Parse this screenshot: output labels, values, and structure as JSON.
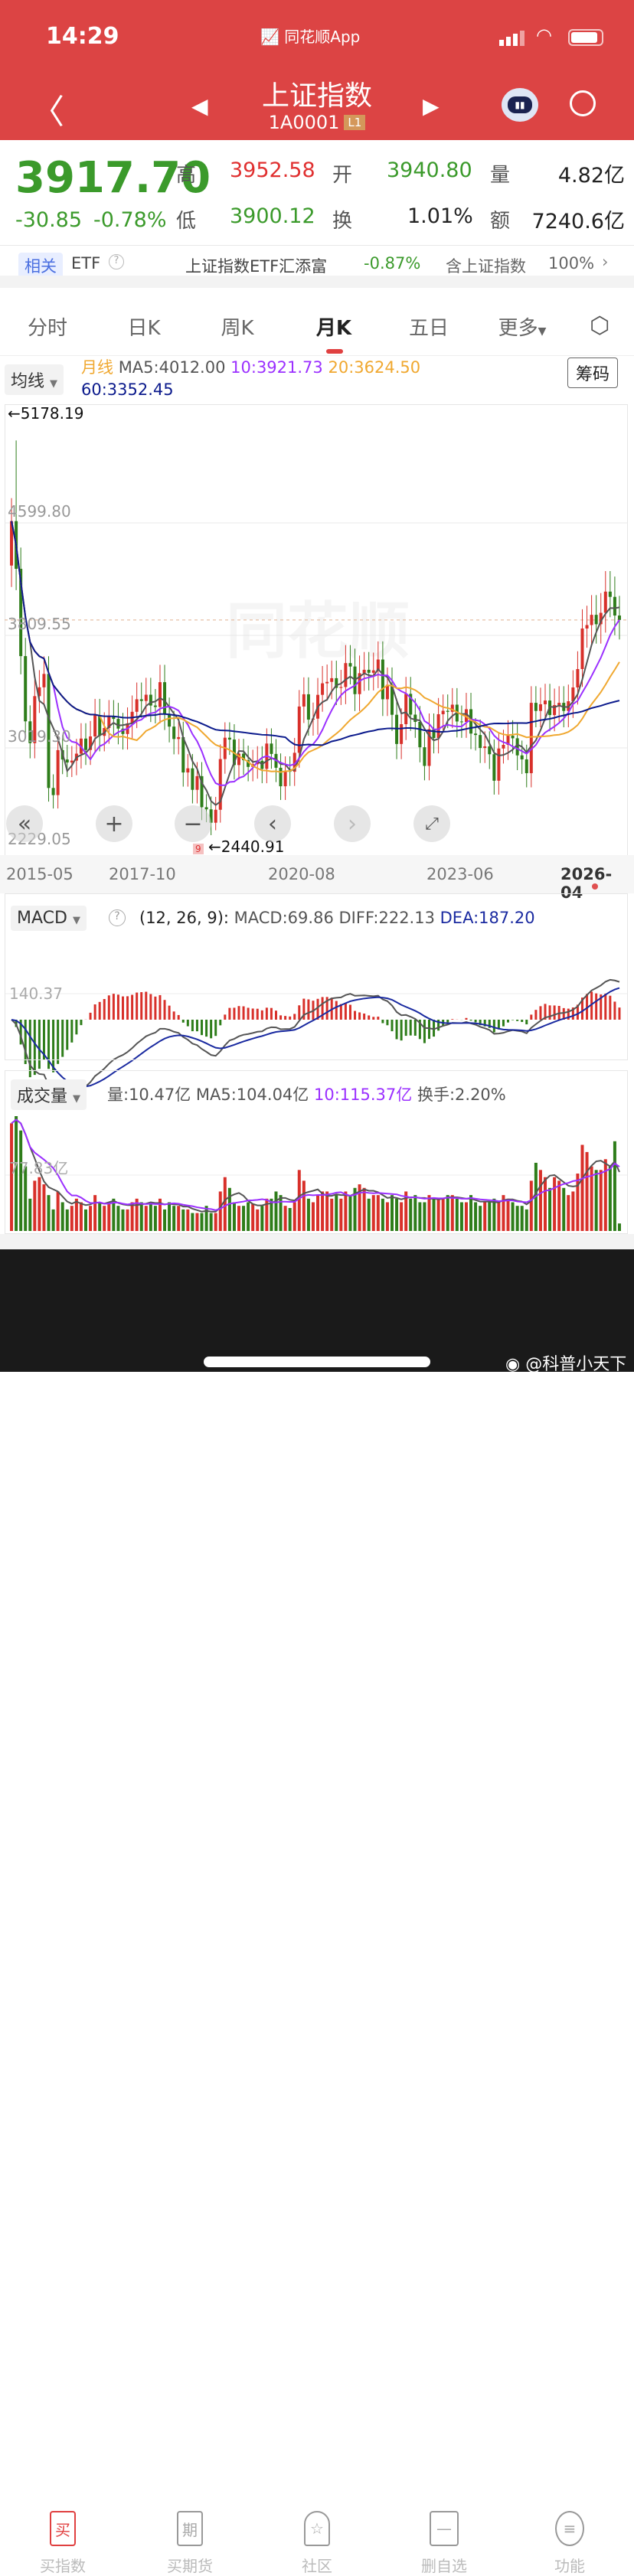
{
  "status": {
    "time": "14:29",
    "app": "同花顺App"
  },
  "header": {
    "title": "上证指数",
    "code": "1A0001",
    "level": "L1"
  },
  "quote": {
    "price": "3917.70",
    "change": "-30.85",
    "change_pct": "-0.78%",
    "high_label": "高",
    "high": "3952.58",
    "open_label": "开",
    "open": "3940.80",
    "vol_label": "量",
    "vol": "4.82亿",
    "low_label": "低",
    "low": "3900.12",
    "turn_label": "换",
    "turn": "1.01%",
    "amt_label": "额",
    "amt": "7240.6亿"
  },
  "etf": {
    "tag": "相关",
    "label": "ETF",
    "name": "上证指数ETF汇添富",
    "pct": "-0.87%",
    "contains": "含上证指数",
    "weight": "100%"
  },
  "tabs": [
    {
      "label": "分时"
    },
    {
      "label": "日K"
    },
    {
      "label": "周K"
    },
    {
      "label": "月K",
      "active": true
    },
    {
      "label": "五日"
    },
    {
      "label": "更多"
    }
  ],
  "ma": {
    "dropdown": "均线",
    "period": "月线",
    "ma5": "MA5:4012.00",
    "ma10": "10:3921.73",
    "ma20": "20:3624.50",
    "ma60": "60:3352.45",
    "chip_button": "筹码"
  },
  "colors": {
    "up": "#d8302a",
    "down": "#2e7d1a",
    "ma5": "#555555",
    "ma10": "#9b30ff",
    "ma20": "#f0a830",
    "ma60": "#0b1a8c",
    "header": "#dc4444"
  },
  "chart_data": {
    "type": "candlestick",
    "y_ticks": [
      "4599.80",
      "3809.55",
      "3019.30",
      "2229.05"
    ],
    "y_tick_values": [
      4599.8,
      3809.55,
      3019.3,
      2229.05
    ],
    "x_labels": [
      "2015-05",
      "2017-10",
      "2020-08",
      "2023-06",
      "2026-04"
    ],
    "x_label_index": [
      0,
      29,
      63,
      97,
      131
    ],
    "max_label": "←5178.19",
    "max_index": 1,
    "max_value": 5178.19,
    "min_label": "←2440.91",
    "min_index": 44,
    "min_value": 2440.91,
    "first_open": 4300,
    "closes": [
      4612,
      4277,
      3664,
      3206,
      3053,
      3383,
      3445,
      3539,
      2738,
      2688,
      3004,
      2938,
      2917,
      2930,
      2979,
      3085,
      3005,
      3100,
      3250,
      3104,
      3159,
      3242,
      3223,
      3155,
      3117,
      3192,
      3273,
      3361,
      3349,
      3393,
      3317,
      3307,
      3481,
      3259,
      3169,
      3082,
      3095,
      2847,
      2876,
      2725,
      2821,
      2603,
      2588,
      2494,
      2585,
      2941,
      3091,
      3078,
      2899,
      2979,
      2933,
      2886,
      2905,
      2929,
      2872,
      3050,
      2977,
      2880,
      2750,
      2860,
      2852,
      2985,
      3310,
      3396,
      3218,
      3225,
      3392,
      3473,
      3483,
      3509,
      3441,
      3447,
      3615,
      3591,
      3397,
      3544,
      3568,
      3547,
      3564,
      3640,
      3361,
      3463,
      3252,
      3047,
      3186,
      3399,
      3253,
      3202,
      3024,
      2893,
      3151,
      3089,
      3256,
      3280,
      3273,
      3323,
      3205,
      3202,
      3291,
      3120,
      3110,
      3019,
      3030,
      2975,
      2789,
      3015,
      3041,
      3105,
      3087,
      2967,
      2939,
      2842,
      3336,
      3279,
      3326,
      3352,
      3250,
      3320,
      3336,
      3279,
      3347,
      3444,
      3573,
      3858,
      3882,
      3954,
      3888,
      3968,
      4117,
      4080,
      3949,
      3918
    ],
    "volumes": [
      150,
      160,
      140,
      90,
      45,
      70,
      75,
      65,
      50,
      30,
      55,
      40,
      30,
      35,
      45,
      40,
      30,
      35,
      50,
      40,
      35,
      40,
      45,
      35,
      30,
      30,
      40,
      45,
      40,
      35,
      40,
      35,
      45,
      30,
      40,
      35,
      35,
      30,
      30,
      25,
      25,
      25,
      35,
      25,
      25,
      55,
      75,
      60,
      40,
      35,
      35,
      40,
      38,
      30,
      35,
      45,
      45,
      55,
      50,
      35,
      32,
      40,
      85,
      70,
      45,
      40,
      50,
      55,
      55,
      45,
      50,
      45,
      55,
      50,
      60,
      65,
      60,
      45,
      50,
      50,
      45,
      40,
      50,
      45,
      40,
      55,
      45,
      50,
      40,
      40,
      50,
      45,
      45,
      45,
      50,
      50,
      45,
      40,
      40,
      50,
      40,
      35,
      40,
      40,
      45,
      40,
      50,
      45,
      40,
      35,
      35,
      30,
      70,
      95,
      85,
      75,
      60,
      75,
      70,
      60,
      50,
      55,
      80,
      120,
      110,
      90,
      85,
      85,
      100,
      90,
      125,
      10.47
    ]
  },
  "macd": {
    "dropdown": "MACD",
    "params": "(12, 26, 9):",
    "macd": "MACD:69.86",
    "diff": "DIFF:222.13",
    "dea": "DEA:187.20",
    "tick": "140.37"
  },
  "volume": {
    "dropdown": "成交量",
    "vol": "量:10.47亿",
    "ma5": "MA5:104.04亿",
    "ma10": "10:115.37亿",
    "turnover": "换手:2.20%",
    "tick": "77.83亿"
  },
  "watermark": "同花顺",
  "nav": [
    {
      "icon": "买",
      "label": "买指数"
    },
    {
      "icon": "期",
      "label": "买期货"
    },
    {
      "icon": "☆",
      "label": "社区"
    },
    {
      "icon": "—",
      "label": "删自选"
    },
    {
      "icon": "≡",
      "label": "功能"
    }
  ],
  "credit": "@科普小天下"
}
